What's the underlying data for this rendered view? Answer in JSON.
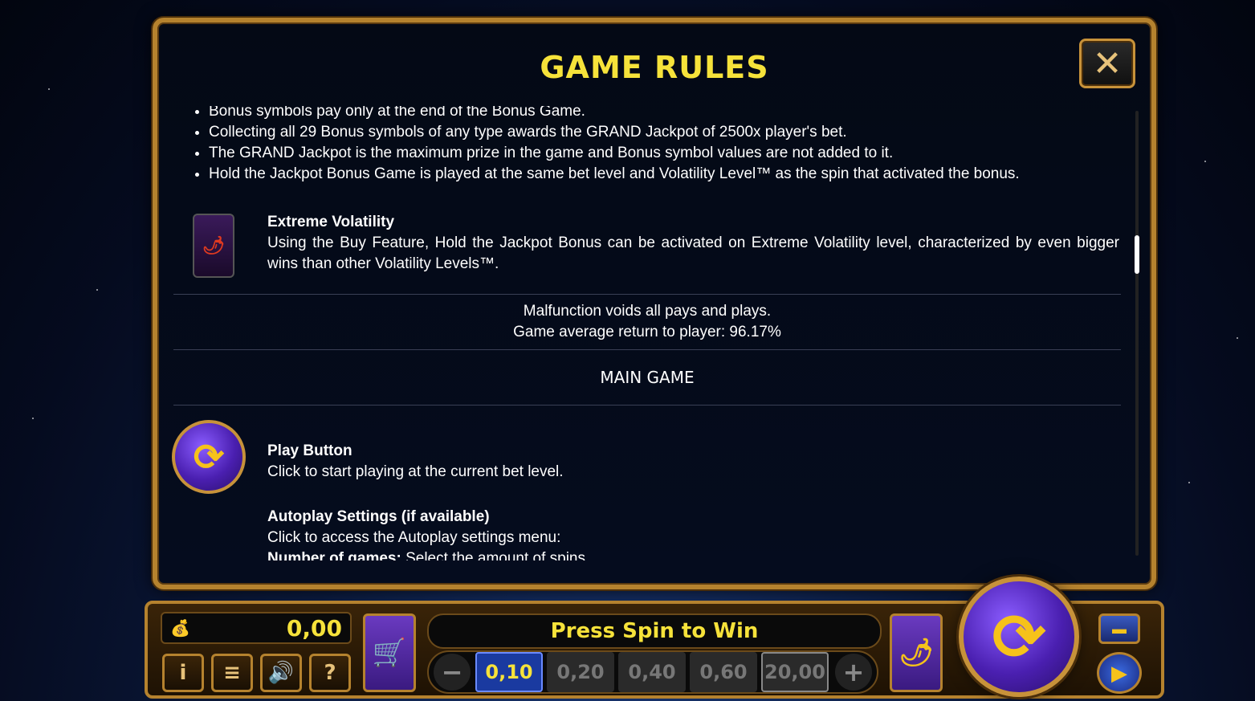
{
  "modal": {
    "title": "GAME RULES",
    "close_icon": "close-icon",
    "bullets": [
      "Bonus symbols pay only at the end of the Bonus Game.",
      "Collecting all 29 Bonus symbols of any type awards the GRAND Jackpot of 2500x player's bet.",
      "The GRAND Jackpot is the maximum prize in the game and Bonus symbol values are not added to it.",
      "Hold the Jackpot Bonus Game is played at the same bet level and Volatility Level™ as the spin that activated the bonus."
    ],
    "extreme_volatility": {
      "title": "Extreme Volatility",
      "desc": "Using the Buy Feature, Hold the Jackpot Bonus can be activated on Extreme Volatility level, characterized by even bigger wins than other Volatility Levels™."
    },
    "malfunction": "Malfunction voids all pays and plays.",
    "rtp": "Game average return to player: 96.17%",
    "main_game_heading": "MAIN GAME",
    "play_button": {
      "title": "Play Button",
      "desc": "Click to start playing at the current bet level."
    },
    "autoplay": {
      "title": "Autoplay Settings (if available)",
      "desc": "Click to access the Autoplay settings menu:",
      "games_label": "Number of games:",
      "games_desc": "Select the amount of spins"
    }
  },
  "bottom_bar": {
    "balance": "0,00",
    "message": "Press Spin to Win",
    "bet_minus": "−",
    "bet_plus": "+",
    "bet_options": [
      "0,10",
      "0,20",
      "0,40",
      "0,60",
      "20,00"
    ],
    "info_label": "i",
    "menu_label": "≡",
    "sound_label": "🔊",
    "help_label": "?"
  }
}
